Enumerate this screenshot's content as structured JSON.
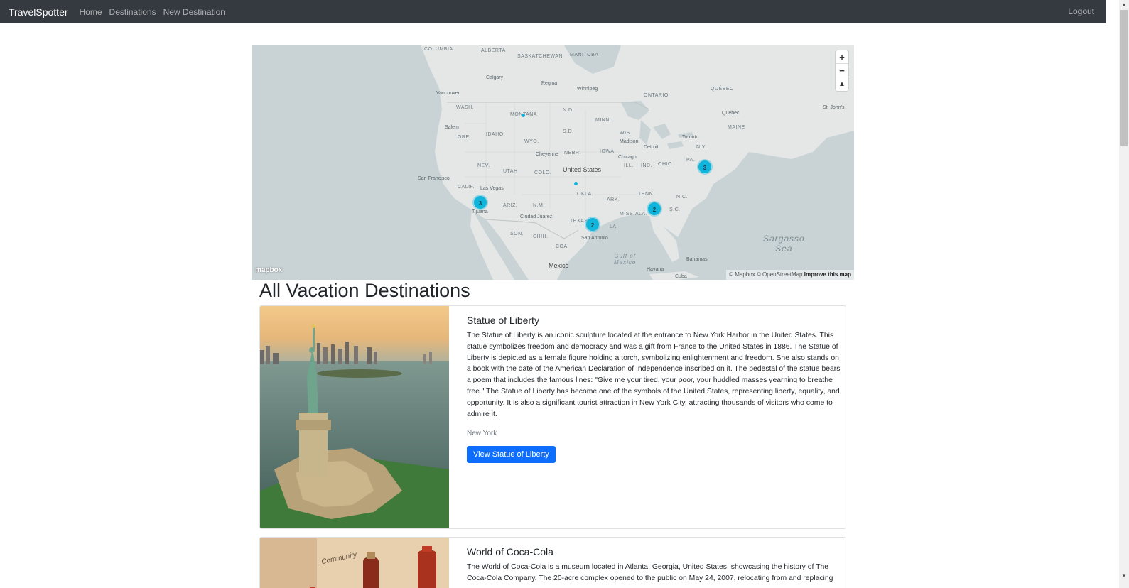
{
  "navbar": {
    "brand": "TravelSpotter",
    "links": [
      "Home",
      "Destinations",
      "New Destination"
    ],
    "logout": "Logout"
  },
  "map": {
    "zoom_in": "+",
    "zoom_out": "−",
    "compass": "▲",
    "logo": "mapbox",
    "attribution": "© Mapbox © OpenStreetMap",
    "improve": "Improve this map",
    "labels": {
      "columbia": "COLUMBIA",
      "alberta": "ALBERTA",
      "saskatchewan": "SASKATCHEWAN",
      "manitoba": "MANITOBA",
      "ontario": "ONTARIO",
      "quebec": "QUÉBEC",
      "maine": "MAINE",
      "wash": "WASH.",
      "mont": "MONTANA",
      "ore": "ORE.",
      "idaho": "IDAHO",
      "wyo": "WYO.",
      "nebr": "NEBR.",
      "iowa": "IOWA",
      "ill": "ILL.",
      "ind": "IND.",
      "ohio": "OHIO",
      "pa": "PA.",
      "ny": "N.Y.",
      "nev": "NEV.",
      "utah": "UTAH",
      "colo": "COLO.",
      "calif": "CALIF.",
      "ariz": "ARIZ.",
      "nm": "N.M.",
      "okla": "OKLA.",
      "ark": "ARK.",
      "tenn": "TENN.",
      "nc": "N.C.",
      "sc": "S.C.",
      "miss": "MISS.",
      "ala": "ALA.",
      "texas": "TEXAS",
      "la": "LA.",
      "son": "SON.",
      "chih": "CHIH.",
      "coa": "COA.",
      "wis": "WIS.",
      "minn": "MINN.",
      "nd": "N.D.",
      "sd": "S.D."
    },
    "cities": {
      "calgary": "Calgary",
      "regina": "Regina",
      "winnipeg": "Winnipeg",
      "vancouver": "Vancouver",
      "salem": "Salem",
      "cheyenne": "Cheyenne",
      "san_francisco": "San Francisco",
      "las_vegas": "Las Vegas",
      "tijuana": "Tijuana",
      "ciudad_juarez": "Ciudad Juárez",
      "chicago": "Chicago",
      "madison": "Madison",
      "detroit": "Detroit",
      "toronto": "Toronto",
      "quebec_city": "Québec",
      "st_johns": "St. John's",
      "san_antonio": "San Antonio",
      "havana": "Havana",
      "bahamas": "Bahamas",
      "cuba": "Cuba"
    },
    "countries": {
      "us": "United States",
      "mexico": "Mexico"
    },
    "seas": {
      "sargasso": "Sargasso\nSea",
      "gulf": "Gulf of\nMexico"
    },
    "clusters": [
      "3",
      "3",
      "2",
      "2"
    ]
  },
  "page": {
    "title": "All Vacation Destinations"
  },
  "destinations": [
    {
      "name": "Statue of Liberty",
      "description": "The Statue of Liberty is an iconic sculpture located at the entrance to New York Harbor in the United States. This statue symbolizes freedom and democracy and was a gift from France to the United States in 1886. The Statue of Liberty is depicted as a female figure holding a torch, symbolizing enlightenment and freedom. She also stands on a book with the date of the American Declaration of Independence inscribed on it. The pedestal of the statue bears a poem that includes the famous lines: \"Give me your tired, your poor, your huddled masses yearning to breathe free.\" The Statue of Liberty has become one of the symbols of the United States, representing liberty, equality, and opportunity. It is also a significant tourist attraction in New York City, attracting thousands of visitors who come to admire it.",
      "location": "New York",
      "button": "View Statue of Liberty"
    },
    {
      "name": "World of Coca-Cola",
      "description": "The World of Coca-Cola is a museum located in Atlanta, Georgia, United States, showcasing the history of The Coca-Cola Company. The 20-acre complex opened to the public on May 24, 2007, relocating from and replacing",
      "image_text": "Community"
    }
  ]
}
